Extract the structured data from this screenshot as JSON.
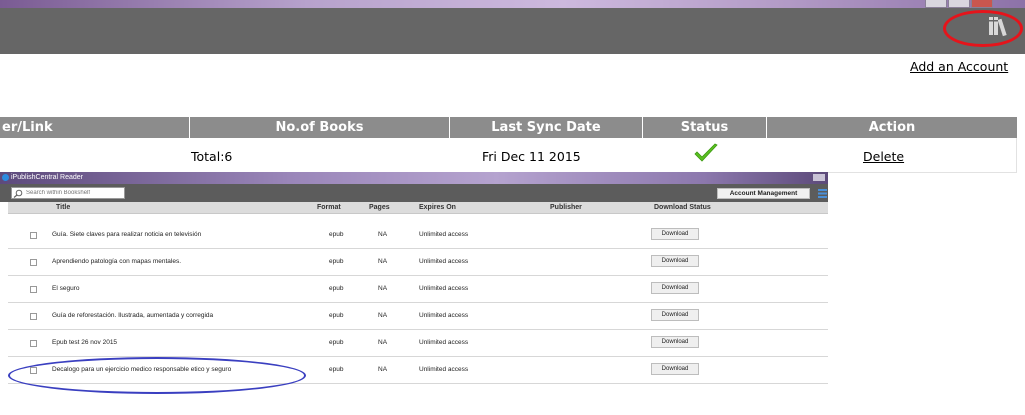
{
  "header": {
    "add_account": "Add an Account"
  },
  "accounts_table": {
    "columns": [
      "er/Link",
      "No.of Books",
      "Last Sync Date",
      "Status",
      "Action"
    ],
    "row": {
      "books": "Total:6",
      "last_sync": "Fri Dec 11 2015",
      "action": "Delete"
    }
  },
  "reader": {
    "window_title": "iPublishCentral Reader",
    "search_placeholder": "Search within Bookshelf",
    "account_button": "Account Management",
    "columns": [
      "Title",
      "Format",
      "Pages",
      "Expires On",
      "Publisher",
      "Download Status"
    ],
    "rows": [
      {
        "title": "Guía. Siete claves para realizar noticia en televisión",
        "format": "epub",
        "pages": "NA",
        "expires": "Unlimited access",
        "publisher": "",
        "action": "Download"
      },
      {
        "title": "Aprendiendo patología con mapas mentales.",
        "format": "epub",
        "pages": "NA",
        "expires": "Unlimited access",
        "publisher": "",
        "action": "Download"
      },
      {
        "title": "El seguro",
        "format": "epub",
        "pages": "NA",
        "expires": "Unlimited access",
        "publisher": "",
        "action": "Download"
      },
      {
        "title": "Guía de reforestación. Ilustrada, aumentada y corregida",
        "format": "epub",
        "pages": "NA",
        "expires": "Unlimited access",
        "publisher": "",
        "action": "Download"
      },
      {
        "title": "Epub test 26 nov 2015",
        "format": "epub",
        "pages": "NA",
        "expires": "Unlimited access",
        "publisher": "",
        "action": "Download"
      },
      {
        "title": "Decalogo para un ejercicio medico responsable etico y seguro",
        "format": "epub",
        "pages": "NA",
        "expires": "Unlimited access",
        "publisher": "",
        "action": "Download"
      }
    ]
  },
  "colors": {
    "header_bg": "#666666",
    "table_header_bg": "#8c8c8c",
    "status_ok": "#5bbf21",
    "highlight_red": "#e5141b",
    "highlight_blue": "#3a3fc0"
  },
  "icons": {
    "bookshelf": "books-icon",
    "status": "checkmark-icon",
    "search": "search-icon",
    "view": "grid-view-icon"
  }
}
